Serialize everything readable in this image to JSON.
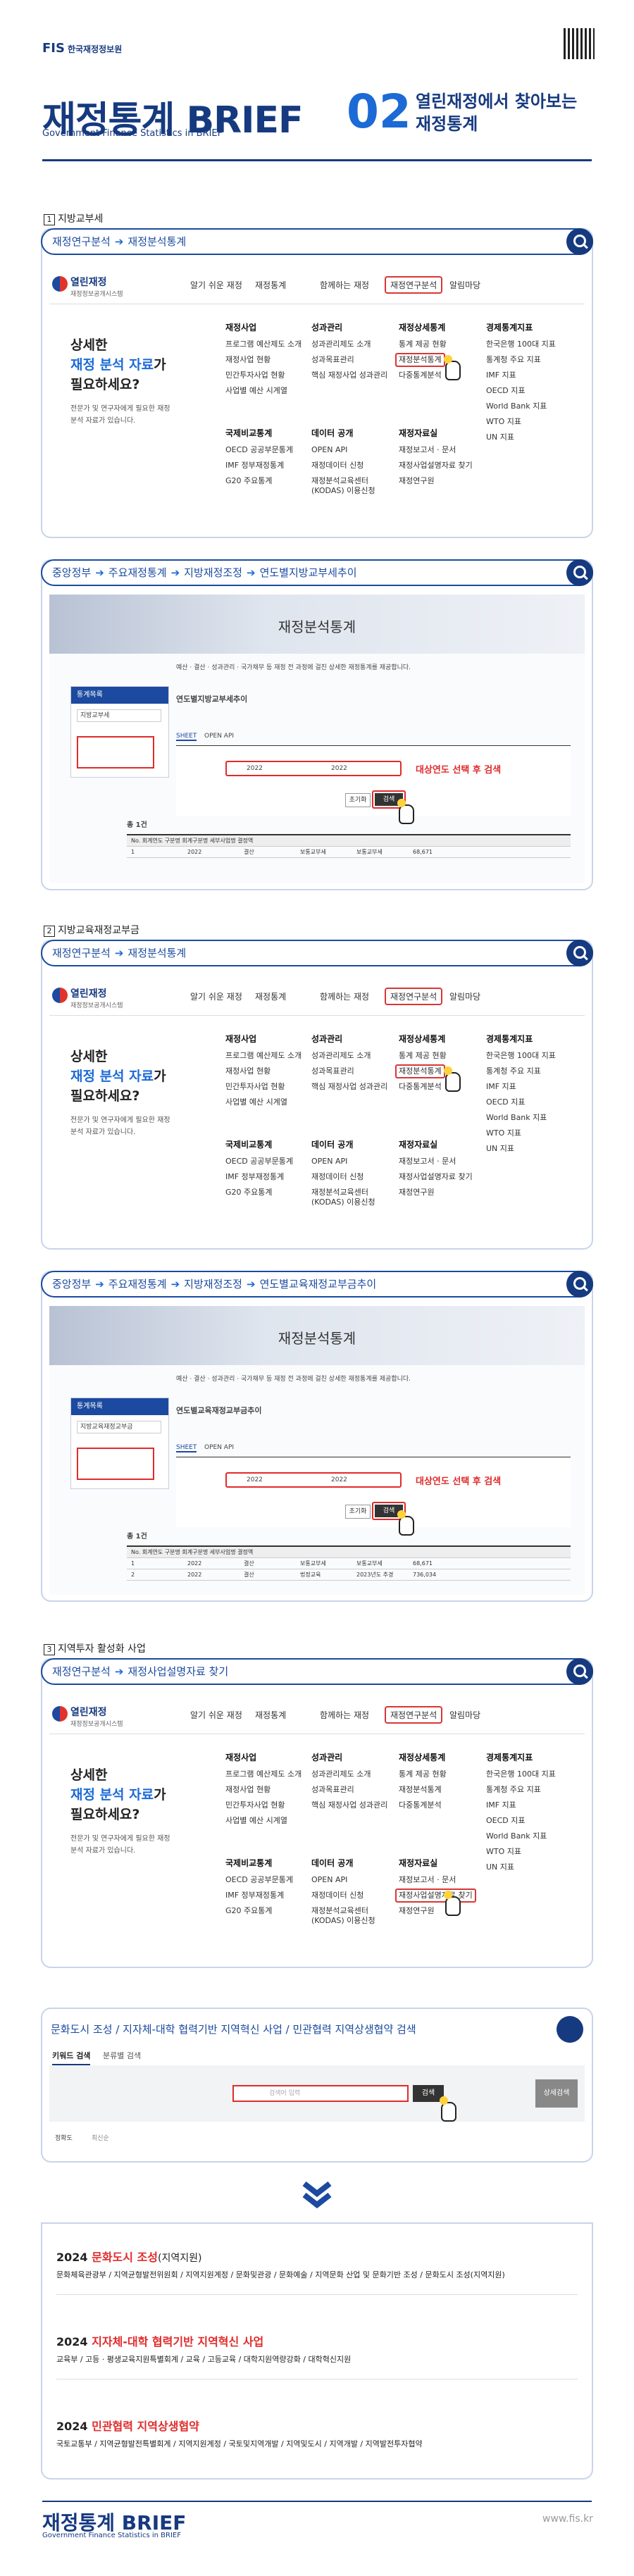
{
  "header": {
    "logo_mark": "FIS",
    "logo_text": "한국재정정보원",
    "title": "재정통계 BRIEF",
    "subtitle": "Government Finance Statistics in BRIEF",
    "issue_no": "02",
    "issue_title_line1": "열린재정에서 찾아보는",
    "issue_title_line2": "재정통계"
  },
  "sections": [
    {
      "num": "1",
      "label": "지방교부세",
      "path1": [
        "재정연구분석",
        "재정분석통계"
      ],
      "path2": [
        "중앙정부",
        "주요재정통계",
        "지방재정조정",
        "연도별지방교부세추이"
      ],
      "page_title": "연도별지방교부세추이",
      "red_note": "대상연도 선택 후 검색",
      "highlight_item": "재정분석통계"
    },
    {
      "num": "2",
      "label": "지방교육재정교부금",
      "path1": [
        "재정연구분석",
        "재정분석통계"
      ],
      "path2": [
        "중앙정부",
        "주요재정통계",
        "지방재정조정",
        "연도별교육재정교부금추이"
      ],
      "page_title": "연도별교육재정교부금추이",
      "red_note": "대상연도 선택 후 검색",
      "highlight_item": "재정분석통계"
    },
    {
      "num": "3",
      "label": "지역투자 활성화 사업",
      "path1": [
        "재정연구분석",
        "재정사업설명자료 찾기"
      ],
      "highlight_item": "재정사업설명자료 찾기"
    }
  ],
  "menu": {
    "brand": "열린재정",
    "brand_sub": "재정정보공개시스템",
    "nav": [
      "알기 쉬운 재정",
      "재정통계",
      "함께하는 재정",
      "재정연구분석",
      "알림마당"
    ],
    "lead_line1": "상세한",
    "lead_line2": "재정 분석 자료",
    "lead_line2b": "가",
    "lead_line3": "필요하세요?",
    "lead_desc_line1": "전문가 및 연구자에게 필요한 재정",
    "lead_desc_line2": "분석 자료가 있습니다.",
    "columns": [
      {
        "title": "재정사업",
        "items": [
          "프로그램 예산제도 소개",
          "재정사업 현황",
          "민간투자사업 현황",
          "사업별 예산 시계열"
        ]
      },
      {
        "title": "성과관리",
        "items": [
          "성과관리제도 소개",
          "성과목표관리",
          "핵심 재정사업 성과관리"
        ]
      },
      {
        "title": "재정상세통계",
        "items": [
          "통계 제공 현황",
          "재정분석통계",
          "다중통계분석"
        ]
      },
      {
        "title": "경제통계지표",
        "items": [
          "한국은행 100대 지표",
          "통계청 주요 지표",
          "IMF 지표",
          "OECD 지표",
          "World Bank 지표",
          "WTO 지표",
          "UN 지표"
        ]
      },
      {
        "title": "국제비교통계",
        "items": [
          "OECD 공공부문통계",
          "IMF 정부재정통계",
          "G20 주요통계"
        ]
      },
      {
        "title": "데이터 공개",
        "items": [
          "OPEN API",
          "재정데이터 신청",
          "재정분석교육센터(KODAS) 이용신청"
        ]
      },
      {
        "title": "재정자료실",
        "items": [
          "재정보고서 · 문서",
          "재정사업설명자료 찾기",
          "재정연구원"
        ]
      }
    ]
  },
  "shot": {
    "banner_title": "재정분석통계",
    "tab_sheet": "SHEET",
    "tab_api": "OPEN API",
    "year_from": "2022",
    "year_to": "2022",
    "btn_reset": "초기화",
    "btn_search": "검색",
    "total": "총 1건",
    "sidebar_title": "통계목록",
    "sidebar_search_placeholder": "지방교부세",
    "notice": "예산 · 결산 · 성과관리 · 국가채무 등 재정 전 과정에 걸친 상세한 재정통계를 제공합니다.",
    "row1": [
      "1",
      "2022",
      "결산",
      "보통교부세",
      "보통교부세",
      "",
      "68,671"
    ],
    "row2": [
      "2",
      "2022",
      "결산",
      "법정교육",
      "2023년도 추경",
      "",
      "736,034"
    ]
  },
  "search": {
    "title_parts": [
      "문화도시 조성",
      "지자체-대학 협력기반 지역혁신 사업",
      "민관협력 지역상생협약 검색"
    ],
    "tab1": "키워드 검색",
    "tab2": "분류별 검색",
    "placeholder": "검색어 입력",
    "btn": "검색",
    "side_btn": "상세검색",
    "filter1": "정확도",
    "filter2": "최신순"
  },
  "results": [
    {
      "year": "2024",
      "title_red": "문화도시 조성",
      "title_tail": "(지역지원)",
      "line": "문화체육관광부 / 지역균형발전위원회 / 지역지원계정 / 문화및관광 / 문화예술 / 지역문화 산업 및 문화기반 조성 / 문화도시 조성(지역지원)"
    },
    {
      "year": "2024",
      "title_red": "지자체-대학 협력기반 지역혁신 사업",
      "title_tail": "",
      "line": "교육부 / 고등 · 평생교육지원특별회계 / 교육 / 고등교육 / 대학지원역량강화 / 대학혁신지원"
    },
    {
      "year": "2024",
      "title_red": "민관협력 지역상생협약",
      "title_tail": "",
      "line": "국토교통부 / 지역균형발전특별회계 / 지역지원계정 / 국토및지역개발 / 지역및도시 / 지역개발 / 지역발전투자협약"
    }
  ],
  "footer": {
    "title": "재정통계 BRIEF",
    "subtitle": "Government Finance Statistics in BRIEF",
    "url": "www.fis.kr"
  }
}
